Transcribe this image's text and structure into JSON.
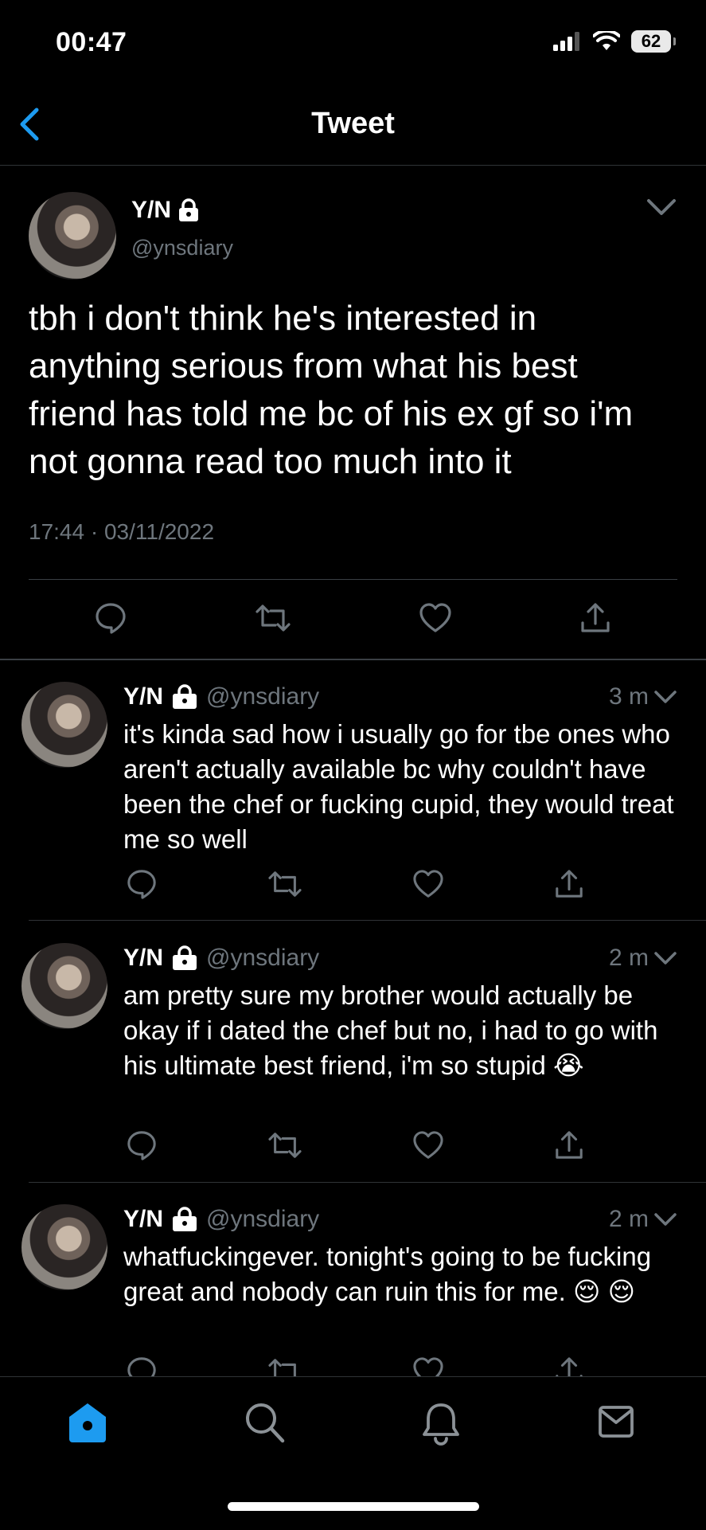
{
  "status_bar": {
    "time": "00:47",
    "battery": "62"
  },
  "nav": {
    "title": "Tweet"
  },
  "main_tweet": {
    "name": "Y/N",
    "handle": "@ynsdiary",
    "text": "tbh i don't think he's interested in anything serious from what his best friend has told me bc of his ex gf so i'm not gonna read too much into it",
    "timestamp": "17:44 · 03/11/2022"
  },
  "replies": [
    {
      "name": "Y/N",
      "handle": "@ynsdiary",
      "time": "3 m",
      "text": "it's kinda sad how i usually go for tbe ones who aren't actually available bc why couldn't have been the chef or fucking cupid, they would treat me so well"
    },
    {
      "name": "Y/N",
      "handle": "@ynsdiary",
      "time": "2 m",
      "text": "am pretty sure my brother would actually be okay if i dated the chef but no, i had to go with his ultimate best friend, i'm so stupid 😭"
    },
    {
      "name": "Y/N",
      "handle": "@ynsdiary",
      "time": "2 m",
      "text": "whatfuckingever. tonight's going to be fucking great and nobody can ruin this for me. 😌 😌"
    }
  ],
  "tab_bar": {
    "active_tab": "home",
    "tabs": [
      "home-icon",
      "search-icon",
      "notifications-icon",
      "messages-icon"
    ]
  },
  "colors": {
    "accent": "#1d9bf0",
    "secondary_text": "#6e767d",
    "background": "#000000"
  }
}
